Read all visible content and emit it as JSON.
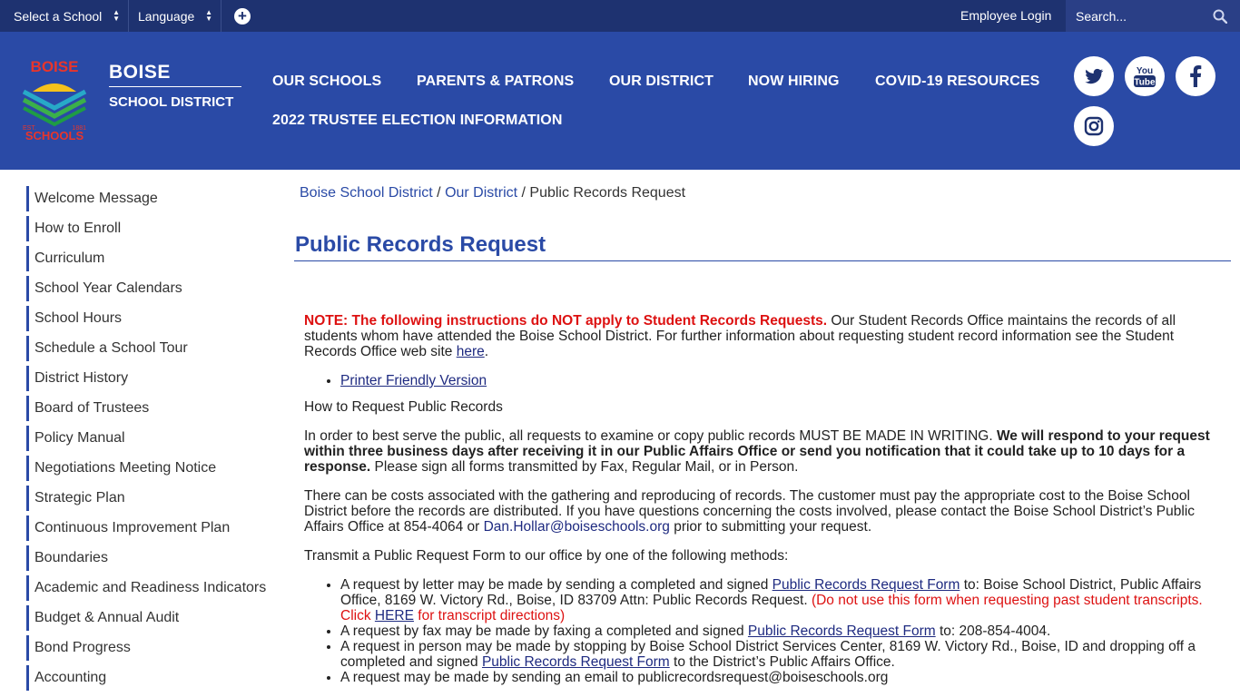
{
  "topbar": {
    "select_school": "Select a School",
    "language": "Language",
    "plus": "+",
    "employee_login": "Employee Login",
    "search_placeholder": "Search..."
  },
  "header": {
    "brand_title": "BOISE",
    "brand_sub": "SCHOOL DISTRICT",
    "logo_text_top": "BOISE",
    "logo_text_est": "EST.",
    "logo_text_year": "1881",
    "logo_text_bottom": "SCHOOLS",
    "nav": [
      "OUR SCHOOLS",
      "PARENTS & PATRONS",
      "OUR DISTRICT",
      "NOW HIRING",
      "COVID-19 RESOURCES",
      "2022 TRUSTEE ELECTION INFORMATION"
    ],
    "social_icons": [
      "twitter-icon",
      "youtube-icon",
      "facebook-icon",
      "instagram-icon"
    ],
    "youtube_text_top": "You",
    "youtube_text_bottom": "Tube"
  },
  "sidebar": {
    "items": [
      "Welcome Message",
      "How to Enroll",
      "Curriculum",
      "School Year Calendars",
      "School Hours",
      "Schedule a School Tour",
      "District History",
      "Board of Trustees",
      "Policy Manual",
      "Negotiations Meeting Notice",
      "Strategic Plan",
      "Continuous Improvement Plan",
      "Boundaries",
      "Academic and Readiness Indicators",
      "Budget & Annual Audit",
      "Bond Progress",
      "Accounting"
    ]
  },
  "breadcrumb": {
    "home": "Boise School District",
    "sep1": " / ",
    "parent": "Our District",
    "sep2": " / ",
    "current": "Public Records Request"
  },
  "main": {
    "title": "Public Records Request",
    "note_bold": "NOTE: The following instructions do NOT apply to Student Records Requests.",
    "note_rest": " Our Student Records Office maintains the records of all students whom have attended the Boise School District. For further information about requesting student record information see the Student Records Office web site ",
    "note_link": "here",
    "note_end": ".",
    "printer_friendly": "Printer Friendly Version",
    "how_to_heading": "How to Request Public Records",
    "p2_start": "In order to best serve the public, all requests to examine or copy public records MUST BE MADE IN WRITING. ",
    "p2_bold": "We will respond to your request within three business days after receiving it in our Public Affairs Office or send you notification that it could take up to 10 days for a response.",
    "p2_end": " Please sign all forms transmitted by Fax, Regular Mail, or in Person.",
    "p3_start": "There can be costs associated with the gathering and reproducing of records. The customer must pay the appropriate cost to the Boise School District before the records are distributed. If you have questions concerning the costs involved, please contact the Boise School District’s Public Affairs Office at 854-4064 or ",
    "p3_email": "Dan.Hollar@boiseschools.org",
    "p3_end": " prior to submitting your request.",
    "p4": "Transmit a Public Request Form to our office by one of the following methods:",
    "li1_start": "A request by letter may be made by sending a completed and signed ",
    "form_link": "Public Records Request Form",
    "li1_mid": " to: Boise School District, Public Affairs Office, 8169 W. Victory Rd., Boise, ID 83709 Attn: Public Records Request.  ",
    "li1_red1": "(Do not use this form when requesting past student transcripts.  Click ",
    "li1_here": "HERE",
    "li1_red2": " for transcript directions)",
    "li2_start": "A request by fax may be made by faxing a completed and signed ",
    "li2_end": " to: 208-854-4004.",
    "li3_start": "A request in person may be made by stopping by Boise School District Services Center, 8169 W. Victory Rd., Boise, ID and dropping off a completed and signed ",
    "li3_end": " to the District’s Public Affairs Office.",
    "li4": "A request may be made by sending an email to publicrecordsrequest@boiseschools.org"
  }
}
